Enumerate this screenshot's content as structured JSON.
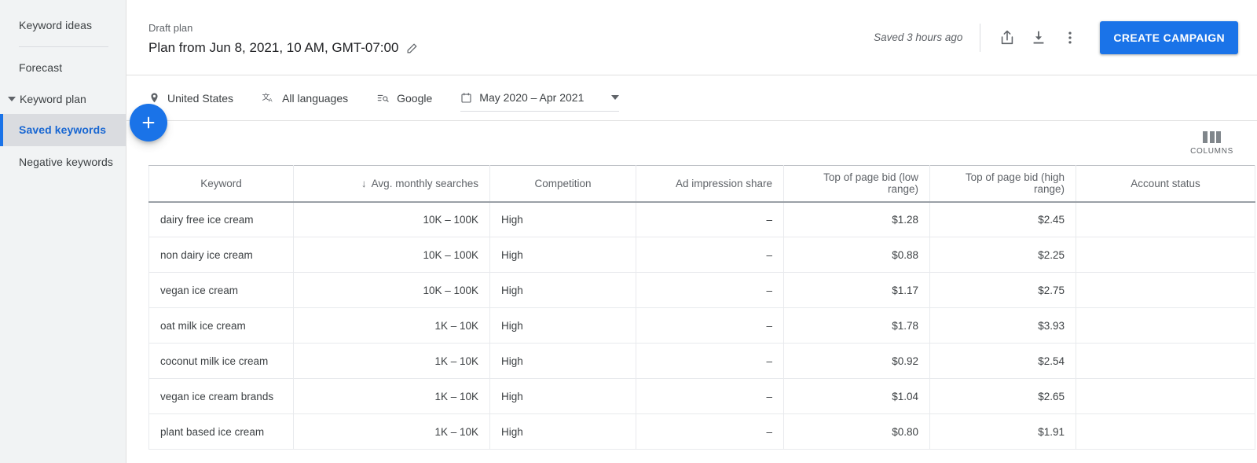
{
  "sidebar": {
    "items": [
      {
        "label": "Keyword ideas",
        "type": "link",
        "active": false
      },
      {
        "label": "Forecast",
        "type": "link",
        "active": false
      },
      {
        "label": "Keyword plan",
        "type": "group",
        "active": false
      },
      {
        "label": "Saved keywords",
        "type": "sub",
        "active": true
      },
      {
        "label": "Negative keywords",
        "type": "sub",
        "active": false
      }
    ]
  },
  "header": {
    "draft_label": "Draft plan",
    "plan_name": "Plan from Jun 8, 2021, 10 AM, GMT-07:00",
    "saved_status": "Saved 3 hours ago",
    "create_campaign_label": "CREATE CAMPAIGN",
    "accent_color": "#1a73e8"
  },
  "filters": {
    "location": "United States",
    "languages": "All languages",
    "network": "Google",
    "date_range": "May 2020 – Apr 2021"
  },
  "toolbar": {
    "columns_label": "COLUMNS",
    "add_label": "+"
  },
  "table": {
    "columns": [
      {
        "label": "Keyword",
        "align": "left",
        "sorted": false
      },
      {
        "label": "Avg. monthly searches",
        "align": "right",
        "sorted": true,
        "sort_arrow": "↓"
      },
      {
        "label": "Competition",
        "align": "left",
        "sorted": false
      },
      {
        "label": "Ad impression share",
        "align": "right",
        "sorted": false
      },
      {
        "label": "Top of page bid (low range)",
        "align": "right",
        "sorted": false
      },
      {
        "label": "Top of page bid (high range)",
        "align": "right",
        "sorted": false
      },
      {
        "label": "Account status",
        "align": "left",
        "sorted": false
      }
    ],
    "rows": [
      {
        "keyword": "dairy free ice cream",
        "avg_monthly_searches": "10K – 100K",
        "competition": "High",
        "ad_impression_share": "–",
        "top_of_page_bid_low": "$1.28",
        "top_of_page_bid_high": "$2.45",
        "account_status": ""
      },
      {
        "keyword": "non dairy ice cream",
        "avg_monthly_searches": "10K – 100K",
        "competition": "High",
        "ad_impression_share": "–",
        "top_of_page_bid_low": "$0.88",
        "top_of_page_bid_high": "$2.25",
        "account_status": ""
      },
      {
        "keyword": "vegan ice cream",
        "avg_monthly_searches": "10K – 100K",
        "competition": "High",
        "ad_impression_share": "–",
        "top_of_page_bid_low": "$1.17",
        "top_of_page_bid_high": "$2.75",
        "account_status": ""
      },
      {
        "keyword": "oat milk ice cream",
        "avg_monthly_searches": "1K – 10K",
        "competition": "High",
        "ad_impression_share": "–",
        "top_of_page_bid_low": "$1.78",
        "top_of_page_bid_high": "$3.93",
        "account_status": ""
      },
      {
        "keyword": "coconut milk ice cream",
        "avg_monthly_searches": "1K – 10K",
        "competition": "High",
        "ad_impression_share": "–",
        "top_of_page_bid_low": "$0.92",
        "top_of_page_bid_high": "$2.54",
        "account_status": ""
      },
      {
        "keyword": "vegan ice cream brands",
        "avg_monthly_searches": "1K – 10K",
        "competition": "High",
        "ad_impression_share": "–",
        "top_of_page_bid_low": "$1.04",
        "top_of_page_bid_high": "$2.65",
        "account_status": ""
      },
      {
        "keyword": "plant based ice cream",
        "avg_monthly_searches": "1K – 10K",
        "competition": "High",
        "ad_impression_share": "–",
        "top_of_page_bid_low": "$0.80",
        "top_of_page_bid_high": "$1.91",
        "account_status": ""
      }
    ]
  }
}
